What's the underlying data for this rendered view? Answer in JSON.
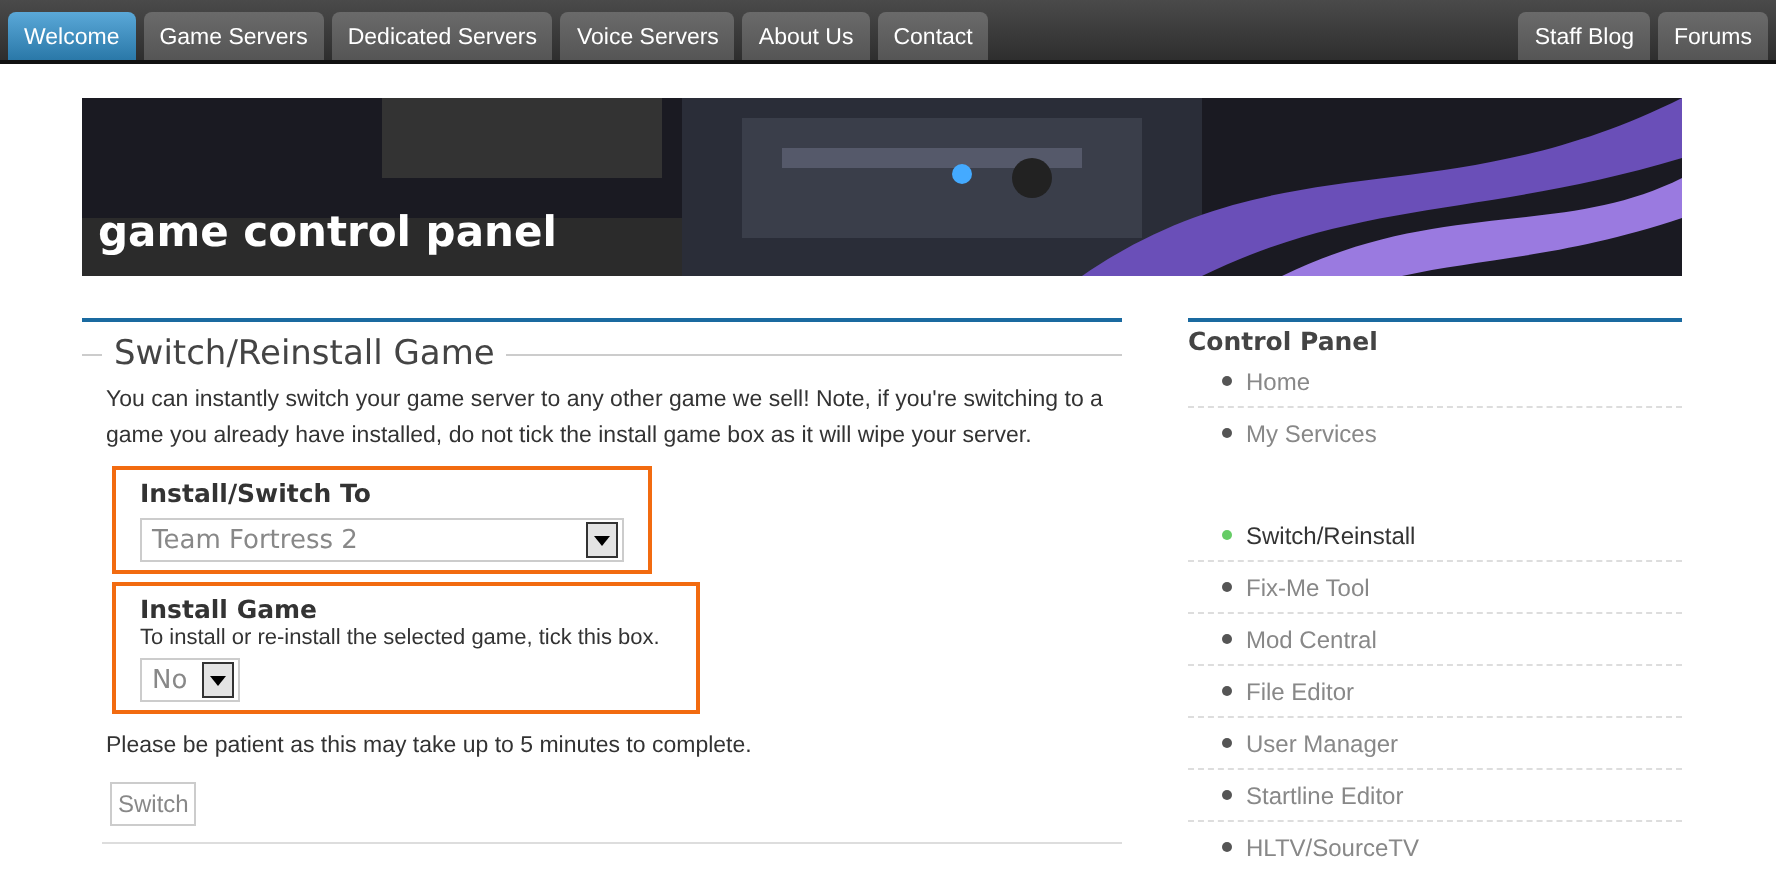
{
  "nav": {
    "left": [
      {
        "label": "Welcome",
        "selected": true
      },
      {
        "label": "Game Servers",
        "selected": false
      },
      {
        "label": "Dedicated Servers",
        "selected": false
      },
      {
        "label": "Voice Servers",
        "selected": false
      },
      {
        "label": "About Us",
        "selected": false
      },
      {
        "label": "Contact",
        "selected": false
      }
    ],
    "right": [
      {
        "label": "Staff Blog",
        "selected": false
      },
      {
        "label": "Forums",
        "selected": false
      }
    ]
  },
  "banner": {
    "title": "game control panel"
  },
  "main": {
    "heading": "Switch/Reinstall Game",
    "intro": "You can instantly switch your game server to any other game we sell! Note, if you're switching to a game you already have installed, do not tick the install game box as it will wipe your server.",
    "fields": [
      {
        "label": "Install/Switch To",
        "value": "Team Fortress 2",
        "kind": "wide"
      },
      {
        "label": "Install Game",
        "hint": "To install or re-install the selected game, tick this box.",
        "value": "No",
        "kind": "narrow"
      }
    ],
    "note": "Please be patient as this may take up to 5 minutes to complete.",
    "button": "Switch"
  },
  "sidebar": {
    "title": "Control Panel",
    "items": [
      {
        "kind": "link",
        "label": "Home",
        "selected": false
      },
      {
        "kind": "link",
        "label": "My Services",
        "selected": false
      },
      {
        "kind": "spacer"
      },
      {
        "kind": "link",
        "label": "Switch/Reinstall",
        "selected": true
      },
      {
        "kind": "link",
        "label": "Fix-Me Tool",
        "selected": false
      },
      {
        "kind": "link",
        "label": "Mod Central",
        "selected": false
      },
      {
        "kind": "link",
        "label": "File Editor",
        "selected": false
      },
      {
        "kind": "link",
        "label": "User Manager",
        "selected": false
      },
      {
        "kind": "link",
        "label": "Startline Editor",
        "selected": false
      },
      {
        "kind": "link",
        "label": "HLTV/SourceTV",
        "selected": false
      }
    ]
  }
}
